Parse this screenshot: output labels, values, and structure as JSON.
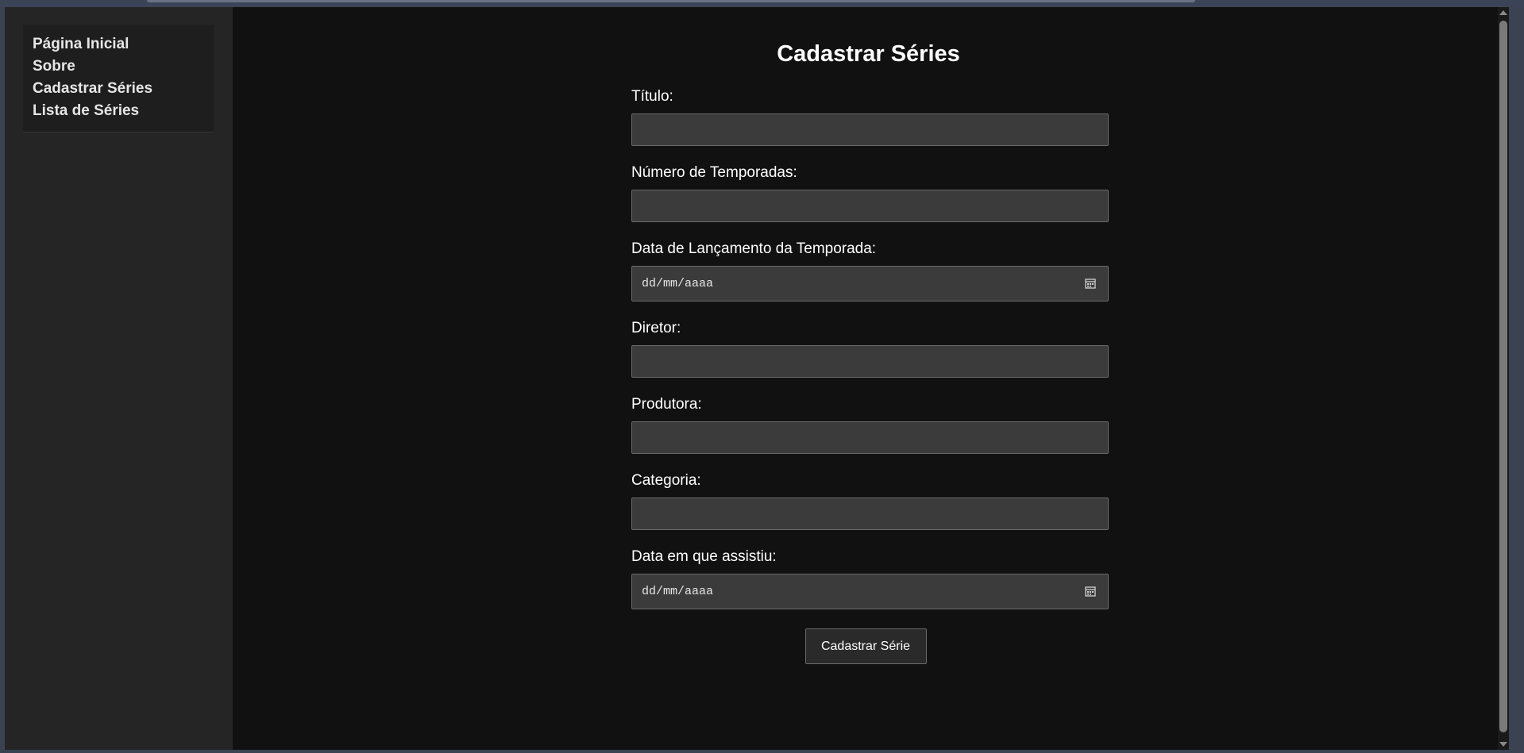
{
  "sidebar": {
    "links": [
      {
        "label": "Página Inicial"
      },
      {
        "label": "Sobre"
      },
      {
        "label": "Cadastrar Séries"
      },
      {
        "label": "Lista de Séries"
      }
    ]
  },
  "main": {
    "title": "Cadastrar Séries"
  },
  "form": {
    "titulo": {
      "label": "Título:",
      "value": ""
    },
    "temporadas": {
      "label": "Número de Temporadas:",
      "value": ""
    },
    "lancamento": {
      "label": "Data de Lançamento da Temporada:",
      "placeholder": "dd/mm/aaaa"
    },
    "diretor": {
      "label": "Diretor:",
      "value": ""
    },
    "produtora": {
      "label": "Produtora:",
      "value": ""
    },
    "categoria": {
      "label": "Categoria:",
      "value": ""
    },
    "assistiu": {
      "label": "Data em que assistiu:",
      "placeholder": "dd/mm/aaaa"
    },
    "submit_label": "Cadastrar Série",
    "date_icon": "calendar-icon"
  },
  "colors": {
    "page_background": "#111111",
    "sidebar_background": "#252525",
    "input_background": "#3b3b3b",
    "text": "#ffffff"
  }
}
